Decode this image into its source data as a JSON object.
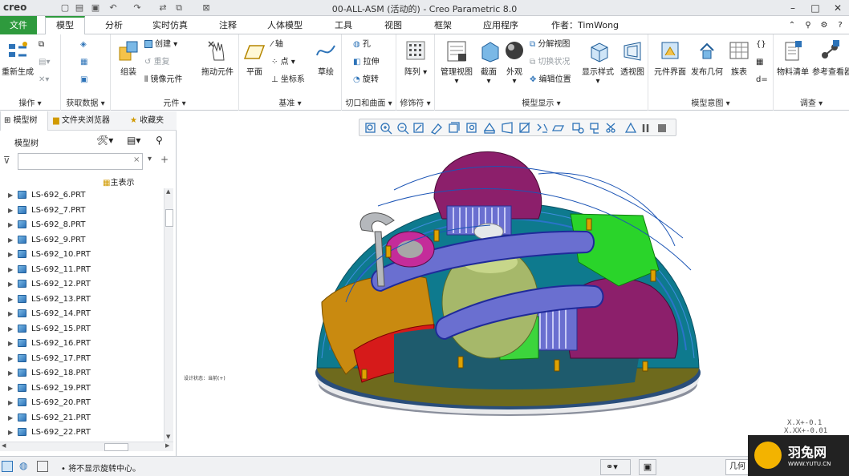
{
  "app": {
    "logo": "creo",
    "window_title": "00-ALL-ASM (活动的) - Creo Parametric 8.0"
  },
  "tabs": [
    "文件",
    "模型",
    "分析",
    "实时仿真",
    "注释",
    "人体模型",
    "工具",
    "视图",
    "框架",
    "应用程序"
  ],
  "author": "作者：TimWong",
  "ribbon": {
    "operations": {
      "regen": "重新生成",
      "label": "操作"
    },
    "getdata": {
      "label": "获取数据"
    },
    "component": {
      "assemble": "组装",
      "create": "创建",
      "repeat": "重复",
      "mirror": "镜像元件",
      "drag": "拖动元件",
      "label": "元件"
    },
    "datum": {
      "plane": "平面",
      "axis": "轴",
      "point": "点",
      "csys": "坐标系",
      "sketch": "草绘",
      "label": "基准"
    },
    "cut": {
      "hole": "孔",
      "extrude": "拉伸",
      "revolve": "旋转",
      "label": "切口和曲面"
    },
    "modifier": {
      "pattern": "阵列",
      "label": "修饰符"
    },
    "display": {
      "manage": "管理视图",
      "section": "截面",
      "appearance": "外观",
      "explode": "分解视图",
      "toggle": "切换状况",
      "edit_pos": "编辑位置",
      "style": "显示样式",
      "persp": "透视图",
      "label": "模型显示"
    },
    "intent": {
      "interface": "元件界面",
      "publish": "发布几何",
      "family": "族表",
      "label": "模型意图"
    },
    "investigate": {
      "bom": "物料清单",
      "ref": "参考查看器",
      "label": "调查"
    }
  },
  "navtabs": [
    "模型树",
    "文件夹浏览器",
    "收藏夹"
  ],
  "tree": {
    "header": "模型树",
    "main_rep": "主表示",
    "items": [
      "LS-692_6.PRT",
      "LS-692_7.PRT",
      "LS-692_8.PRT",
      "LS-692_9.PRT",
      "LS-692_10.PRT",
      "LS-692_11.PRT",
      "LS-692_12.PRT",
      "LS-692_13.PRT",
      "LS-692_14.PRT",
      "LS-692_15.PRT",
      "LS-692_16.PRT",
      "LS-692_17.PRT",
      "LS-692_18.PRT",
      "LS-692_19.PRT",
      "LS-692_20.PRT",
      "LS-692_21.PRT",
      "LS-692_22.PRT"
    ]
  },
  "viewport": {
    "orient_note": "设计状态：当前(+)",
    "tol1": "X.X+-0.1",
    "tol2": "X.XX+-0.01"
  },
  "status": {
    "message": "• 将不显示旋转中心。",
    "geom": "几何"
  },
  "watermark": {
    "brand": "羽兔网",
    "url": "WWW.YUTU.CN"
  },
  "colors": {
    "file_tab": "#2e9a3d",
    "accent": "#0b5fa5"
  }
}
